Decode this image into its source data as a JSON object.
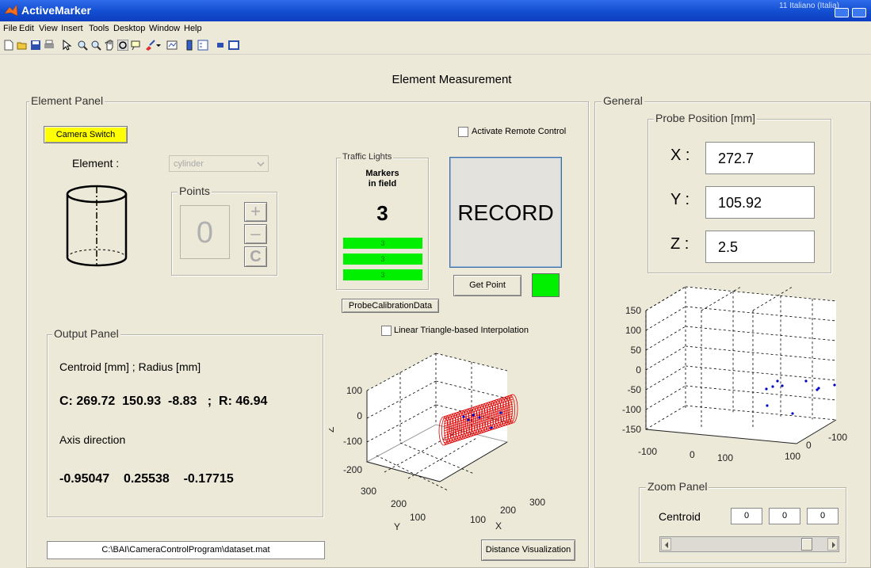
{
  "window": {
    "title": "ActiveMarker",
    "user_text": "11 Italiano (Italia)"
  },
  "menu": [
    "File",
    "Edit",
    "View",
    "Insert",
    "Tools",
    "Desktop",
    "Window",
    "Help"
  ],
  "toolbar_icons": [
    "new-file-icon",
    "open-folder-icon",
    "save-icon",
    "print-icon",
    "arrow-cursor-icon",
    "zoom-in-icon",
    "zoom-out-icon",
    "pan-hand-icon",
    "rotate-3d-icon",
    "data-cursor-icon",
    "brush-icon",
    "dropdown-arrow-icon",
    "link-plot-icon",
    "colorbar-icon",
    "legend-icon",
    "hide-tools-icon",
    "show-tools-icon"
  ],
  "heading": "Element Measurement",
  "element_panel": {
    "title": "Element Panel",
    "camera_switch": "Camera Switch",
    "element_label": "Element  :",
    "element_value": "cylinder",
    "points_title": "Points",
    "points_count": "0",
    "plus": "+",
    "minus": "–",
    "clear": "C"
  },
  "remote": {
    "label": "Activate Remote Control",
    "checked": false
  },
  "traffic": {
    "title": "Traffic Lights",
    "markers_label_1": "Markers",
    "markers_label_2": "in field",
    "count": "3",
    "bars": [
      "3",
      "3",
      "3"
    ],
    "bar_color": "#00f000"
  },
  "record_label": "RECORD",
  "get_point_label": "Get Point",
  "status_color": "#00f000",
  "probe_calibration_label": "ProbeCalibrationData",
  "interpolation": {
    "label": "Linear Triangle-based Interpolation",
    "checked": false
  },
  "output_panel": {
    "title": "Output Panel",
    "centroid_label": "Centroid [mm] ; Radius [mm]",
    "centroid_line": "C: 269.72  150.93  -8.83   ;  R: 46.94",
    "axis_label": "Axis direction",
    "axis_line": "-0.95047    0.25538    -0.17715"
  },
  "dataset_path": "C:\\BAI\\CameraControlProgram\\dataset.mat",
  "distance_button": "Distance Visualization",
  "general_panel": {
    "title": "General",
    "probe_title": "Probe Position [mm]",
    "x_label": "X :",
    "y_label": "Y :",
    "z_label": "Z :",
    "x_value": "272.7",
    "y_value": "105.92",
    "z_value": "2.5"
  },
  "zoom_panel": {
    "title": "Zoom Panel",
    "centroid_label": "Centroid",
    "values": [
      "0",
      "0",
      "0"
    ],
    "slider_fraction": 0.9
  },
  "chart_data": [
    {
      "type": "scatter",
      "projection": "3d",
      "series": [
        {
          "marker": "cylinder-mesh",
          "color": "#e00000"
        },
        {
          "marker": "point",
          "color": "#0000c0"
        }
      ],
      "z_ticks": [
        "100",
        "0",
        "-100",
        "-200"
      ],
      "y_ticks": [
        "300",
        "200",
        "100"
      ],
      "x_ticks": [
        "100",
        "200",
        "300"
      ],
      "zlabel": "Z",
      "ylabel": "Y",
      "xlabel": "X",
      "grid": true
    },
    {
      "type": "scatter",
      "projection": "3d",
      "series": [
        {
          "marker": "point",
          "color": "#0000c0"
        }
      ],
      "z_ticks": [
        "150",
        "100",
        "50",
        "0",
        "-50",
        "-100",
        "-150"
      ],
      "left_ticks": [
        "-100",
        "0",
        "100"
      ],
      "right_ticks": [
        "100",
        "0",
        "-100"
      ],
      "grid": true
    }
  ]
}
